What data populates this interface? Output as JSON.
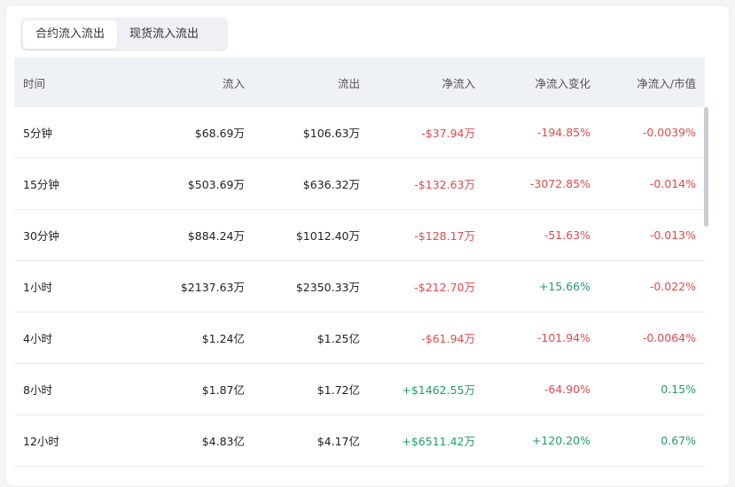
{
  "tabs": [
    {
      "label": "合约流入流出",
      "active": true
    },
    {
      "label": "现货流入流出",
      "active": false
    }
  ],
  "table": {
    "headers": [
      "时间",
      "流入",
      "流出",
      "净流入",
      "净流入变化",
      "净流入/市值"
    ],
    "rows": [
      {
        "time": "5分钟",
        "inflow": "$68.69万",
        "outflow": "$106.63万",
        "net": "-$37.94万",
        "net_change": "-194.85%",
        "net_mcap": "-0.0039%"
      },
      {
        "time": "15分钟",
        "inflow": "$503.69万",
        "outflow": "$636.32万",
        "net": "-$132.63万",
        "net_change": "-3072.85%",
        "net_mcap": "-0.014%"
      },
      {
        "time": "30分钟",
        "inflow": "$884.24万",
        "outflow": "$1012.40万",
        "net": "-$128.17万",
        "net_change": "-51.63%",
        "net_mcap": "-0.013%"
      },
      {
        "time": "1小时",
        "inflow": "$2137.63万",
        "outflow": "$2350.33万",
        "net": "-$212.70万",
        "net_change": "+15.66%",
        "net_mcap": "-0.022%"
      },
      {
        "time": "4小时",
        "inflow": "$1.24亿",
        "outflow": "$1.25亿",
        "net": "-$61.94万",
        "net_change": "-101.94%",
        "net_mcap": "-0.0064%"
      },
      {
        "time": "8小时",
        "inflow": "$1.87亿",
        "outflow": "$1.72亿",
        "net": "+$1462.55万",
        "net_change": "-64.90%",
        "net_mcap": "0.15%"
      },
      {
        "time": "12小时",
        "inflow": "$4.83亿",
        "outflow": "$4.17亿",
        "net": "+$6511.42万",
        "net_change": "+120.20%",
        "net_mcap": "0.67%"
      }
    ]
  },
  "colors": {
    "negative": "#e5484d",
    "positive": "#1f9d6b",
    "header_bg": "#eef1f5"
  }
}
